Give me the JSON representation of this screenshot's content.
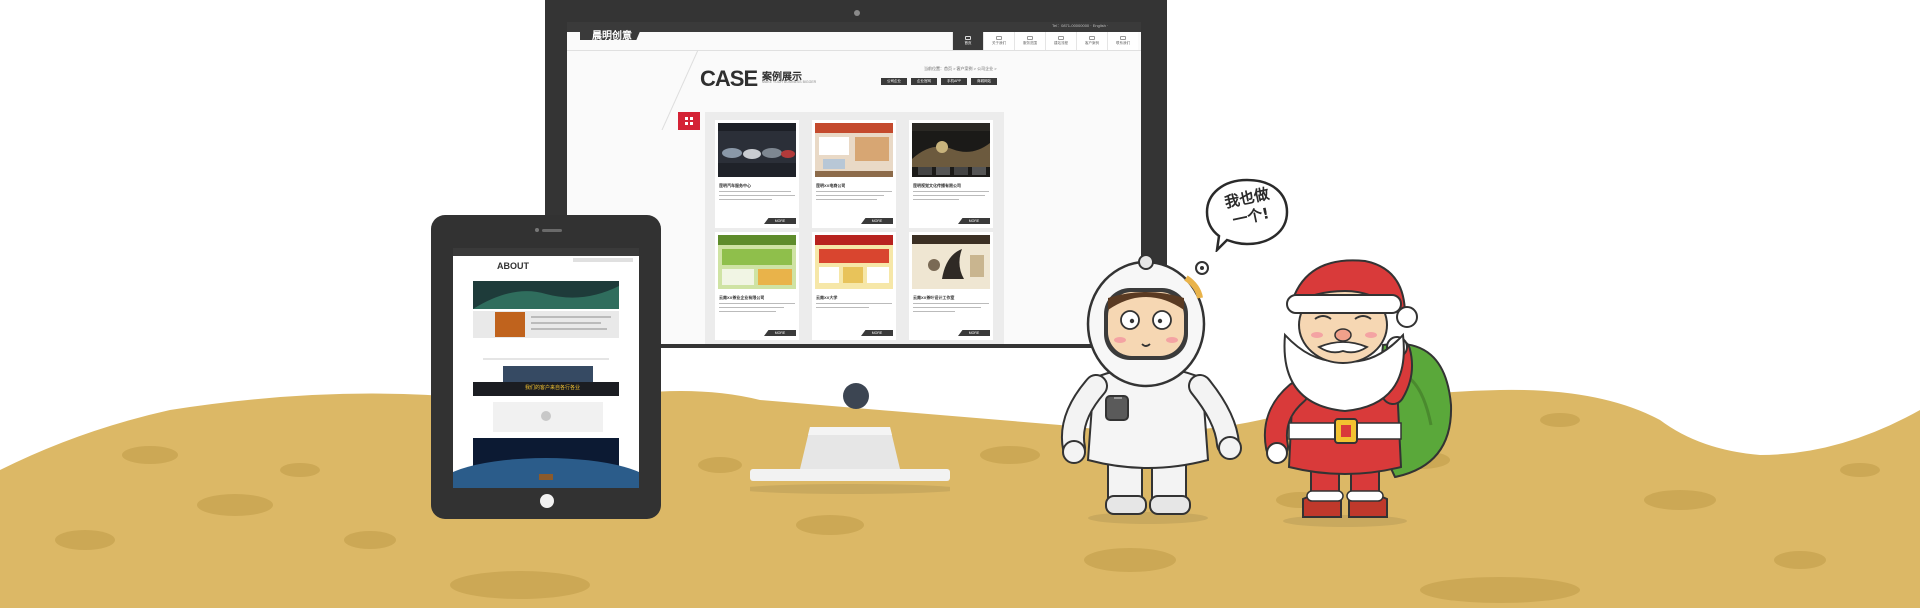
{
  "colors": {
    "sand": "#dcb866",
    "sand_dark": "#cca855",
    "device_frame": "#343434",
    "accent_red": "#d42235",
    "site_dark": "#3a3a3a"
  },
  "monitor_site": {
    "logo": "晨明创意",
    "top_info": "Tel：0871-00000000  ·  English  ·",
    "nav": [
      {
        "label": "首页",
        "active": true
      },
      {
        "label": "关于我们",
        "active": false
      },
      {
        "label": "服务范围",
        "active": false
      },
      {
        "label": "建站流程",
        "active": false
      },
      {
        "label": "客户案例",
        "active": false
      },
      {
        "label": "联系我们",
        "active": false
      }
    ],
    "case_heading": "CASE",
    "case_heading_cn": "案例展示",
    "case_subheading": "MAKE YOUR BUSINESS BIGGER",
    "breadcrumb": "当前位置：首页 > 客户案例 > 公司企业 >",
    "filters": [
      "公司企业",
      "企业官网",
      "手机APP",
      "商城网站"
    ],
    "cards": [
      {
        "title": "昆明汽车服务中心",
        "more": "MORE"
      },
      {
        "title": "昆明XX电商公司",
        "more": "MORE"
      },
      {
        "title": "昆明视觉文化传播有限公司",
        "more": "MORE"
      },
      {
        "title": "云南XX茶业企业有限公司",
        "more": "MORE"
      },
      {
        "title": "云南XX大学",
        "more": "MORE"
      },
      {
        "title": "云南XX茶叶设计工作室",
        "more": "MORE"
      }
    ]
  },
  "tablet_site": {
    "about_heading": "ABOUT",
    "banner_text": "我们的客户来自各行各业"
  },
  "bubble": {
    "text": "我也做一个!"
  },
  "characters": [
    "astronaut",
    "santa-claus"
  ]
}
